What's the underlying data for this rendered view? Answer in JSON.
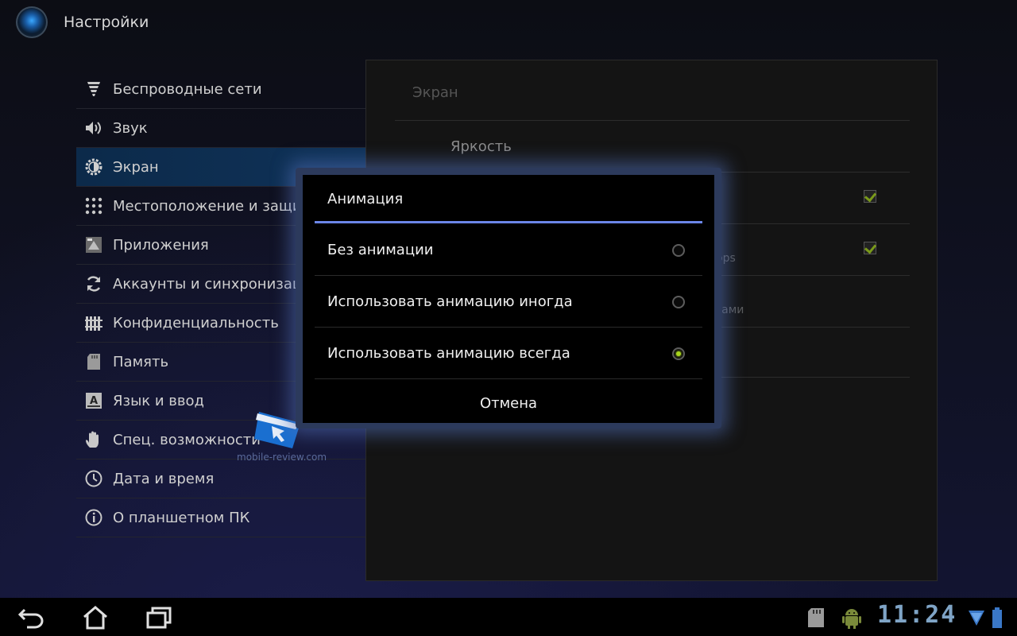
{
  "app": {
    "title": "Настройки",
    "icon": "settings-app-icon"
  },
  "menu": {
    "items": [
      {
        "label": "Беспроводные сети",
        "icon": "wireless-icon"
      },
      {
        "label": "Звук",
        "icon": "speaker-icon"
      },
      {
        "label": "Экран",
        "icon": "brightness-icon",
        "selected": true
      },
      {
        "label": "Местоположение и защита",
        "icon": "location-grid-icon"
      },
      {
        "label": "Приложения",
        "icon": "apps-icon"
      },
      {
        "label": "Аккаунты и синхронизация",
        "icon": "sync-icon"
      },
      {
        "label": "Конфиденциальность",
        "icon": "privacy-icon"
      },
      {
        "label": "Память",
        "icon": "sdcard-icon"
      },
      {
        "label": "Язык и ввод",
        "icon": "keyboard-icon"
      },
      {
        "label": "Спец. возможности",
        "icon": "hand-icon"
      },
      {
        "label": "Дата и время",
        "icon": "clock-icon"
      },
      {
        "label": "О планшетном ПК",
        "icon": "info-icon"
      }
    ]
  },
  "panel": {
    "header": "Экран",
    "brightness": "Яркость",
    "partial_sub1": "ops",
    "partial_sub2": "нами"
  },
  "dialog": {
    "title": "Анимация",
    "options": [
      {
        "label": "Без анимации",
        "selected": false
      },
      {
        "label": "Использовать анимацию иногда",
        "selected": false
      },
      {
        "label": "Использовать анимацию всегда",
        "selected": true
      }
    ],
    "cancel": "Отмена"
  },
  "watermark": {
    "text": "mobile-review.com"
  },
  "system_bar": {
    "time": "11:24",
    "icons": [
      "back-icon",
      "home-icon",
      "recent-apps-icon",
      "sdcard-status-icon",
      "android-debug-icon",
      "wifi-icon",
      "battery-icon"
    ]
  },
  "colors": {
    "accent": "#6b86e8",
    "radio_on": "#a8d61c",
    "selected_bg": "#0f3258",
    "clock": "#7fa4c6"
  }
}
